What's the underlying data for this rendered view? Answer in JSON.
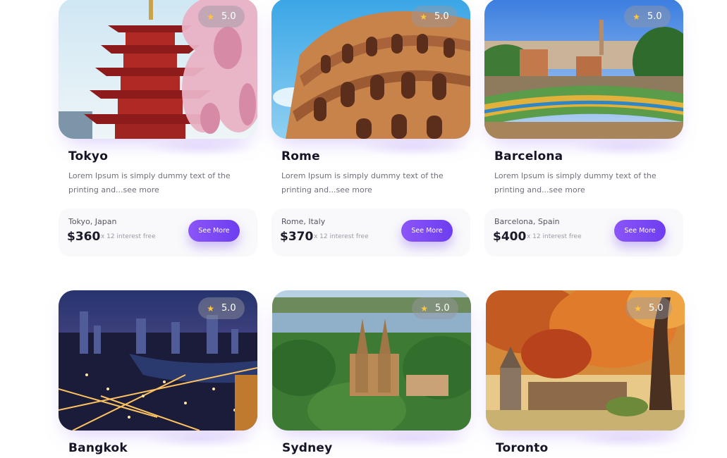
{
  "cards": [
    {
      "title": "Tokyo",
      "rating": "5.0",
      "description": "Lorem Ipsum is simply dummy text of the printing and...see more",
      "location": "Tokyo, Japan",
      "price": "$360",
      "installment": "x 12 interest free",
      "button": "See More"
    },
    {
      "title": "Rome",
      "rating": "5.0",
      "description": "Lorem Ipsum is simply dummy text of the printing and...see more",
      "location": "Rome, Italy",
      "price": "$370",
      "installment": "x 12 interest free",
      "button": "See More"
    },
    {
      "title": "Barcelona",
      "rating": "5.0",
      "description": "Lorem Ipsum is simply dummy text of the printing and...see more",
      "location": "Barcelona, Spain",
      "price": "$400",
      "installment": "x 12 interest free",
      "button": "See More"
    },
    {
      "title": "Bangkok",
      "rating": "5.0"
    },
    {
      "title": "Sydney",
      "rating": "5.0"
    },
    {
      "title": "Toronto",
      "rating": "5.0"
    }
  ],
  "colors": {
    "accent": "#7b4af5",
    "star": "#ffc53d"
  },
  "icons": {
    "rating": "star-icon"
  }
}
